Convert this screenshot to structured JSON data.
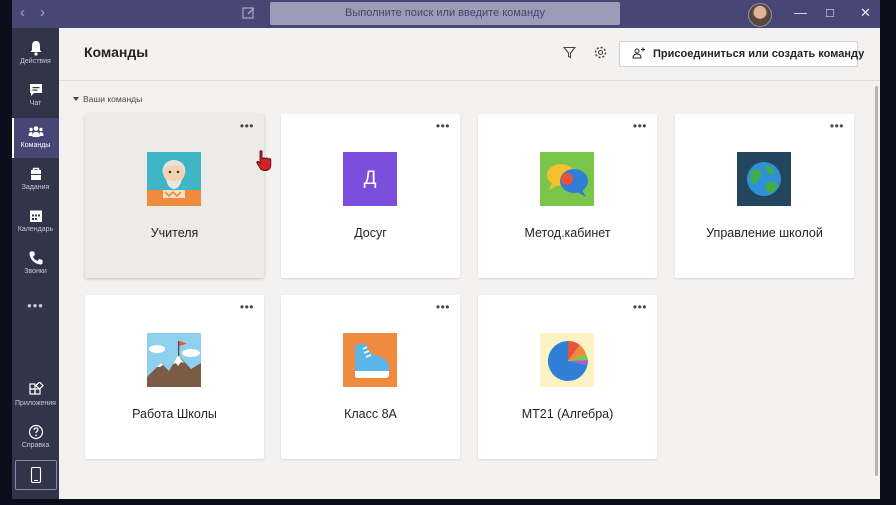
{
  "search": {
    "placeholder": "Выполните поиск или введите команду"
  },
  "rail": {
    "items": [
      {
        "label": "Действия",
        "icon": "bell-icon"
      },
      {
        "label": "Чат",
        "icon": "chat-icon"
      },
      {
        "label": "Команды",
        "icon": "teams-icon",
        "active": true
      },
      {
        "label": "Задания",
        "icon": "assignments-icon"
      },
      {
        "label": "Календарь",
        "icon": "calendar-icon"
      },
      {
        "label": "Звонки",
        "icon": "phone-icon"
      }
    ],
    "more": "•••",
    "apps_label": "Приложения",
    "help_label": "Справка"
  },
  "header": {
    "title": "Команды",
    "join_button": "Присоединиться или создать команду"
  },
  "section": {
    "label": "Ваши команды"
  },
  "teams": [
    {
      "name": "Учителя",
      "tile": "teacher"
    },
    {
      "name": "Досуг",
      "tile": "letter",
      "letter": "Д",
      "color": "#7b4fdb"
    },
    {
      "name": "Метод.кабинет",
      "tile": "bubbles"
    },
    {
      "name": "Управление школой",
      "tile": "globe"
    },
    {
      "name": "Работа Школы",
      "tile": "mountain"
    },
    {
      "name": "Класс 8А",
      "tile": "shoe"
    },
    {
      "name": "МТ21 (Алгебра)",
      "tile": "pie"
    }
  ],
  "card_more": "•••",
  "colors": {
    "titlebar": "#464775",
    "rail": "#33344a",
    "accent": "#6264a7"
  }
}
